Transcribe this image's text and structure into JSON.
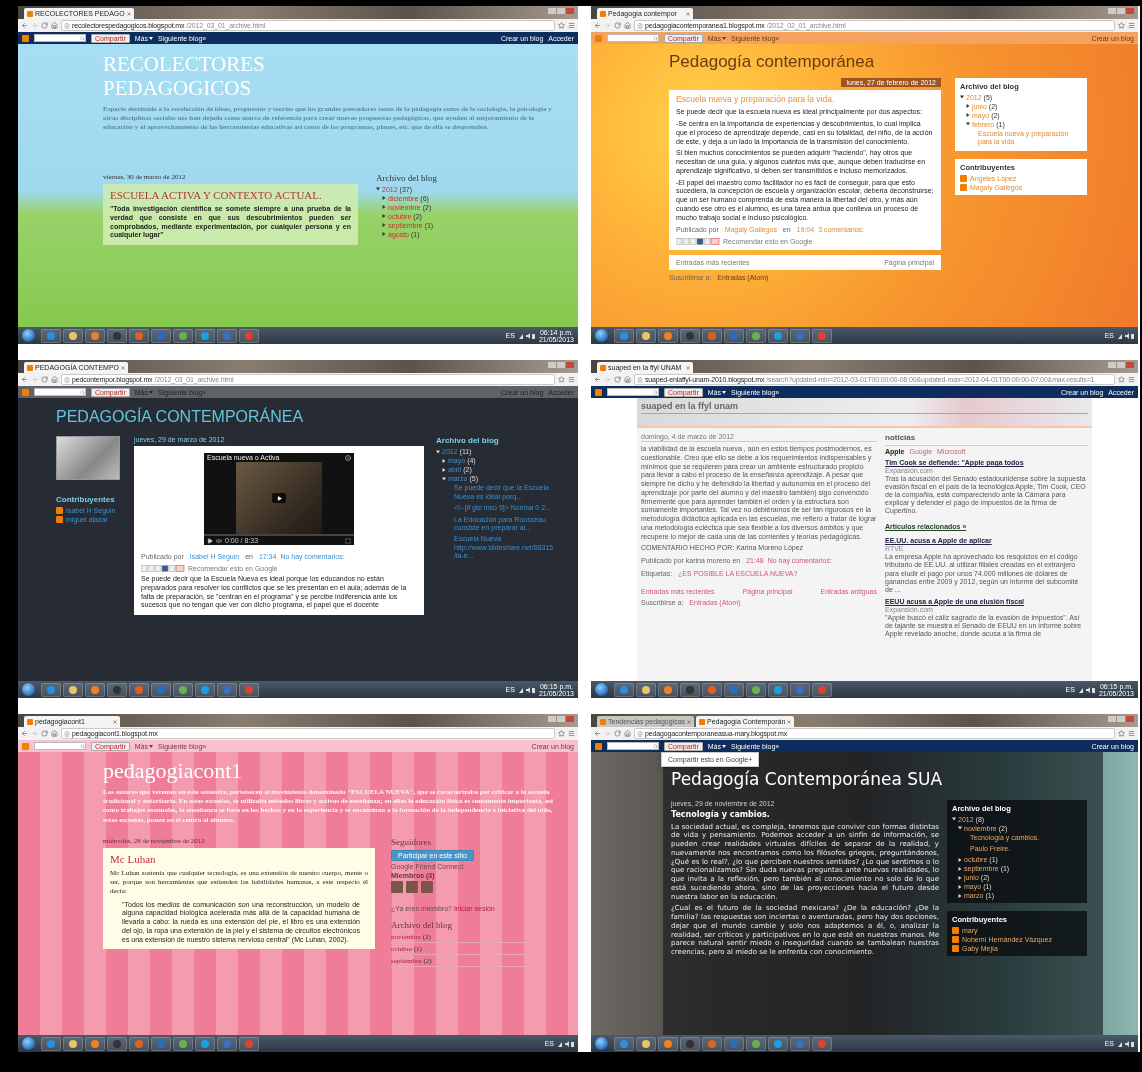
{
  "panels": [
    {
      "kind": "grass",
      "tabs": [
        {
          "label": "RECOLECTORES PEDAGO",
          "selected": true
        }
      ],
      "url": {
        "host": "recolectorespedagogicos.blogspot.mx",
        "path": "/2012_03_01_archive.html"
      },
      "navbar": {
        "share": "Compartir",
        "left": [
          {
            "label": "Más",
            "menu": true
          },
          {
            "label": "Siguiente blog»",
            "menu": false
          }
        ],
        "right": [
          "Crear un blog",
          "Acceder"
        ]
      },
      "header": {
        "title": "RECOLECTORES PEDAGOGICOS",
        "description": "Espacio destinado a la recolección de ideas, propuestas y teorías que los grandes pensadores tanto de la pedagogía como de la sociología, la psicología y otras disciplinas sociales nos han dejado como marco de referencia para crear nuevas propuestas pedagógicas, que ayuden al mejoramiento de la educación y al aprovechamiento de las herramientas educativas así como de los programas, planes, etc. que de ella se desprenden."
      },
      "main": {
        "date": "viernes, 30 de marzo de 2012",
        "post": {
          "title": "ESCUELA ACTIVA Y CONTEXTO ACTUAL.",
          "blocks": [
            {
              "kind": "text",
              "text": "\"Toda investigación científica se somete siempre a una prueba de la verdad que consiste en que sus descubrimientos pueden ser comprobados, mediante experimentación, por cualquier persona y en cualquier lugar\""
            }
          ]
        }
      },
      "sidebar": [
        {
          "kind": "tree",
          "heading": "Archivo del blog",
          "items": [
            {
              "label": "2012",
              "count": "(37)",
              "expanded": true,
              "children": [
                {
                  "label": "diciembre",
                  "count": "(6)",
                  "expanded": false
                },
                {
                  "label": "noviembre",
                  "count": "(2)",
                  "expanded": false
                },
                {
                  "label": "octubre",
                  "count": "(2)",
                  "expanded": false
                },
                {
                  "label": "septiembre",
                  "count": "(1)",
                  "expanded": false
                },
                {
                  "label": "agosto",
                  "count": "(1)",
                  "expanded": false
                }
              ]
            }
          ]
        }
      ],
      "taskbar": {
        "lang": "ES",
        "time": "06:14 p.m.",
        "date": "21/05/2013"
      }
    },
    {
      "kind": "orange",
      "tabs": [
        {
          "label": "Pedagogía contempor",
          "selected": true
        }
      ],
      "url": {
        "host": "pedagogiacontemporanea1.blogspot.mx",
        "path": "/2012_02_01_archive.html"
      },
      "navbar": {
        "share": "Compartir",
        "left": [
          {
            "label": "Más",
            "menu": true
          },
          {
            "label": "Siguiente blog»",
            "menu": false
          }
        ],
        "right": [
          "Crear un blog"
        ]
      },
      "header": {
        "title": "Pedagogía contemporánea"
      },
      "main": {
        "date": "lunes, 27 de febrero de 2012",
        "post": {
          "title": "Escuela nueva y preparación para la vida.",
          "blocks": [
            {
              "kind": "text",
              "text": "Se puede decir que la escuela nueva es ideal principalmente por dos aspectos:"
            },
            {
              "kind": "text",
              "text": "-Se centra en la importancia de experiencias y descubrimientos, lo cual implica que el proceso de aprendizaje depende, casi en su totalidad, del niño, de la acción de este, y deja a un lado la importancia de la transmisión del conocimiento."
            },
            {
              "kind": "text",
              "text": "Si bien muchos conocimientos se pueden adquirir \"haciendo\", hay otros que necesitan de una guía, y algunos cuántos más que, aunque deben traducirse en aprendizaje significativo, si deben ser transmitidos e incluso memorizados."
            },
            {
              "kind": "text",
              "text": "-El papel del maestro como facilitador no es fácil de conseguir, para que esto sucediera, la concepción de escuela y organización escolar, debería deconstruirse; que un ser humano comprenda de esta manera la libertad del otro, y más aún cuando ese otro es el alumno, es una tarea ardua que conlleva un proceso de mucho trabajo social e incluso psicológico."
            },
            {
              "kind": "byline",
              "segments": [
                {
                  "text": "Publicado por ",
                  "link": false
                },
                {
                  "text": "Magaly Gallegos",
                  "link": true
                },
                {
                  "text": " en ",
                  "link": false
                },
                {
                  "text": "19:04",
                  "link": true
                },
                {
                  "text": "3 comentarios:",
                  "link": true
                }
              ]
            },
            {
              "kind": "share",
              "text": "Recomendar esto en Google"
            }
          ]
        },
        "after": [
          {
            "kind": "pager",
            "items": [
              "Entradas más recientes",
              "Página principal"
            ]
          },
          {
            "kind": "subscribe",
            "segments": [
              {
                "text": "Suscribirse a: ",
                "link": false
              },
              {
                "text": "Entradas (Atom)",
                "link": true
              }
            ]
          }
        ]
      },
      "sidebar": [
        {
          "kind": "tree",
          "heading": "Archivo del blog",
          "items": [
            {
              "label": "2012",
              "count": "(5)",
              "expanded": true,
              "children": [
                {
                  "label": "junio",
                  "count": "(2)",
                  "expanded": false
                },
                {
                  "label": "mayo",
                  "count": "(2)",
                  "expanded": false
                },
                {
                  "label": "febrero",
                  "count": "(1)",
                  "expanded": true,
                  "posts": [
                    "Escuela nueva y preparación para la vida"
                  ]
                }
              ]
            }
          ]
        },
        {
          "kind": "people",
          "heading": "Contribuyentes",
          "items": [
            "Angeles López",
            "Magaly Gallegos"
          ]
        }
      ],
      "taskbar": {
        "lang": "ES"
      }
    },
    {
      "kind": "dark",
      "tabs": [
        {
          "label": "PEDAGOGÍA CONTEMPO",
          "selected": true
        }
      ],
      "url": {
        "host": "pedcontempor.blogspot.mx",
        "path": "/2012_03_01_archive.html"
      },
      "navbar": {
        "share": "Compartir",
        "left": [
          {
            "label": "Más",
            "menu": true
          },
          {
            "label": "Siguiente blog»",
            "menu": false
          }
        ],
        "right": [
          "Crear un blog",
          "Acceder"
        ]
      },
      "header": {
        "title": "PEDAGOGÍA CONTEMPORÁNEA"
      },
      "left": [
        {
          "kind": "image"
        },
        {
          "kind": "people",
          "heading": "Contribuyentes",
          "items": [
            "Isabel H Seguin",
            "miguel alazar"
          ]
        }
      ],
      "main": {
        "date": "jueves, 29 de marzo de 2012",
        "post": {
          "blocks": [
            {
              "kind": "video",
              "title": "Escuela nueva o Activa",
              "time": "0:00 / 8:33"
            },
            {
              "kind": "byline",
              "segments": [
                {
                  "text": "Publicado por ",
                  "link": false
                },
                {
                  "text": "Isabel H Seguin",
                  "link": true
                },
                {
                  "text": " en ",
                  "link": false
                },
                {
                  "text": "17:34",
                  "link": true
                },
                {
                  "text": "No hay comentarios:",
                  "link": true
                }
              ]
            },
            {
              "kind": "share",
              "text": "Recomendar esto en Google"
            },
            {
              "kind": "text",
              "text": "Se puede decir que la Escuela Nueva es ideal porque los educandos no están preparados para resolver los conflictos que se les presentan en el aula; además de la falta de preparación, se \"centran en el programa\" y se percibe indiferencia ante los sucesos que no tengan que ver con dicho programa, el papel que el docente"
            }
          ]
        }
      },
      "sidebar": [
        {
          "kind": "tree",
          "heading": "Archivo del blog",
          "items": [
            {
              "label": "2012",
              "count": "(11)",
              "expanded": true,
              "children": [
                {
                  "label": "mayo",
                  "count": "(4)",
                  "expanded": false
                },
                {
                  "label": "abril",
                  "count": "(2)",
                  "expanded": false
                },
                {
                  "label": "marzo",
                  "count": "(5)",
                  "expanded": true,
                  "posts": [
                    "Se puede decir que la Escuela Nueva es ideal porq...",
                    "<!--[if gte mso 9]> Normal 0 2...",
                    "La Educación para Rousseau consiste en preparar al...",
                    "Escuela Nueva http://www.slideshare.net/88315/la-e..."
                  ]
                }
              ]
            }
          ]
        }
      ],
      "taskbar": {
        "lang": "ES",
        "time": "06:15 p.m.",
        "date": "21/05/2013"
      }
    },
    {
      "kind": "plain",
      "tabs": [
        {
          "label": "suaped en la ffyl UNAM",
          "selected": true
        }
      ],
      "url": {
        "host": "suaped-enlaffyl-unam-2010.blogspot.mx",
        "path": "/search?updated-min=2012-03-01T00:00:00-08:00&updated-max=2012-04-01T00:00:00-07:00&max-results=1"
      },
      "navbar": {
        "share": "Compartir",
        "left": [
          {
            "label": "Más",
            "menu": true
          },
          {
            "label": "Siguiente blog»",
            "menu": false
          }
        ],
        "right": [
          "Crear un blog",
          "Acceder"
        ]
      },
      "header": {
        "title": "suaped en la ffyl unam"
      },
      "main": {
        "date": "domingo, 4 de marzo de 2012",
        "post": {
          "blocks": [
            {
              "kind": "text",
              "text": "la viabilidad de la escuela nueva , aún en estos tiempos postmodernos, es cuestionable. Creo que ello se debe a los requerimientos indispensables y mínimos que se requieren para crear un ambiente estructurado propicio para llevar a cabo el proceso de la enseñanza aprendizaje. A pesar que siempre he dicho y he defendido la libertad y autonomía en el proceso del aprendizaje por parte del alumno y del maestro también) sigo convencido firmemente que para aprender también el orden y la estructura son sumamente importantes. Tal vez no debiéramos de ser tan rigurosos en la metodología didáctica aplicada en las escuelas, me refiero a tratar de lograr una metodología ecléctica que sea flexible a los diversos ámbitos y que recupere lo mejor de cada una de las corrientes y teorías pedagógicas."
            },
            {
              "kind": "text",
              "text": "COMENTARIO HECHO POR: Karina Moreno López"
            },
            {
              "kind": "byline",
              "segments": [
                {
                  "text": "Publicado por karina moreno en ",
                  "link": false
                },
                {
                  "text": "21:48",
                  "link": true
                },
                {
                  "text": "No hay comentarios:",
                  "link": true
                }
              ]
            },
            {
              "kind": "byline",
              "segments": [
                {
                  "text": "Etiquetas: ",
                  "link": false
                },
                {
                  "text": "¿ES POSIBLE LA ESCUELA NUEVA?",
                  "link": true
                }
              ]
            }
          ]
        },
        "after": [
          {
            "kind": "pager",
            "items": [
              "Entradas más recientes",
              "Página principal",
              "Entradas antiguas"
            ]
          },
          {
            "kind": "subscribe",
            "segments": [
              {
                "text": "Suscribirse a: ",
                "link": false
              },
              {
                "text": "Entradas (Atom)",
                "link": true
              }
            ]
          }
        ]
      },
      "sidebar": [
        {
          "kind": "news",
          "heading": "noticias",
          "tabs": [
            {
              "label": "Apple",
              "selected": true
            },
            {
              "label": "Google",
              "selected": false
            },
            {
              "label": "Microsoft",
              "selected": false
            }
          ],
          "items": [
            {
              "title": "Tim Cook se defiende: \"Apple paga todos",
              "source": "Expansión.com",
              "text": "Tras la acusación del Senado estadounidense sobre la supuesta evasión fiscal en el país de la tecnológica Apple, Tim Cook, CEO de la compañía, está compareciendo ante la Cámara para explicar y defender el pago de impuestos de la firma de Cupertino.",
              "related": "Artículos relacionados »"
            },
            {
              "title": "EE.UU. acusa a Apple de aplicar",
              "source": "RTVE",
              "text": "La empresa Apple ha aprovechado los resquicios en el código tributario de EE.UU. al utilizar filiales creadas en el extranjero para eludir el pago por unos 74.000 millones de dólares de ganancias entre 2009 y 2012, según un informe del subcomité de ..."
            },
            {
              "title": "EEUU acusa a Apple de una elusión fiscal",
              "source": "Expansión.com",
              "text": "\"Apple buscó el cáliz sagrado de la evasión de impuestos\". Así de tajante se muestra el Senado de EEUU en un informe sobre Apple revelado anoche, donde acusa a la firma de"
            }
          ]
        }
      ],
      "taskbar": {
        "lang": "ES",
        "time": "06:15 p.m.",
        "date": "21/05/2013"
      }
    },
    {
      "kind": "pink",
      "tabs": [
        {
          "label": "pedagogiacont1",
          "selected": true
        }
      ],
      "url": {
        "host": "pedagogiacont1.blogspot.mx"
      },
      "navbar": {
        "share": "Compartir",
        "left": [
          {
            "label": "Más",
            "menu": true
          },
          {
            "label": "Siguiente blog»",
            "menu": false
          }
        ],
        "right": [
          "Crear un blog"
        ]
      },
      "header": {
        "title": "pedagogiacont1",
        "description": "Los autores que veremos en este semestre, pertenecen al movimiento denominado \"ESCUELA NUEVA\", que se caracterizaba por criticar a la escuela tradicional y autoritaria. En estas escuelas, se utilizaba métodos libres y activos de enseñanza; en ellas la educación física es sumamente importante, así como trabajos manuales, la enseñanza se basa en los hechos y en la experiencia y se encaminan a la formación de la independencia e iniciativa del niño, estas escuelas, ponen en el centro al alumno."
      },
      "main": {
        "date": "miércoles, 28 de noviembre de 2012",
        "post": {
          "title": "Mc Luhan",
          "blocks": [
            {
              "kind": "text",
              "text": "Mc Luhan sostenía que cualquier tecnología, es una extensión de nuestro cuerpo, mente o ser, porque son herramientas que extienden las habilidades humanas, a este respecto él decía:"
            },
            {
              "kind": "quote",
              "text": "\"Todos los medios de comunicación son una reconstrucción, un modelo de alguna capacidad biológica acelerada más allá de la capacidad humana de llevarla a cabo: la rueda es una extensión del pie, el libro es una extensión del ojo, la ropa una extensión de la piel y el sistema de circuitos electrónicos es una extensión de nuestro sistema nervioso central\" (Mc Luhan, 2002)."
            }
          ]
        }
      },
      "sidebar": [
        {
          "kind": "followers",
          "heading": "Seguidores",
          "button": "Participar en este sitio",
          "caption": "Google Friend Connect",
          "members": "Miembros (3)",
          "question": "¿Ya eres miembro?",
          "link": "Iniciar sesión"
        },
        {
          "kind": "list",
          "heading": "Archivo del blog",
          "items": [
            {
              "label": "noviembre",
              "count": "(2)"
            },
            {
              "label": "octubre",
              "count": "(1)"
            },
            {
              "label": "septiembre",
              "count": "(2)"
            }
          ]
        }
      ],
      "taskbar": {
        "lang": "ES"
      }
    },
    {
      "kind": "photo",
      "tabs": [
        {
          "label": "Tendencias pedagógicas",
          "selected": false
        },
        {
          "label": "Pedagogía Contemporán",
          "selected": true
        }
      ],
      "url": {
        "host": "pedagogacontemporaneasua-mary.blogspot.mx"
      },
      "navbar": {
        "share": "Compartir",
        "left": [
          {
            "label": "Más",
            "menu": true
          },
          {
            "label": "Siguiente blog»",
            "menu": false
          }
        ],
        "right": [
          "Crear un blog"
        ]
      },
      "popup": "Compartir esto en Google+",
      "header": {
        "title": "Pedagogía Contemporánea SUA"
      },
      "main": {
        "date": "jueves, 29 de noviembre de 2012",
        "post": {
          "title": "Tecnología y cambios.",
          "blocks": [
            {
              "kind": "text",
              "text": "La sociedad actual, es compleja, tenemos que convivir con formas distintas de vida y pensamiento. Podemos acceder a un sinfín de información, se pueden crear realidades virtuales difíciles de separar de la realidad, y nuevamente nos encontramos como los filósofos griegos, preguntándonos, ¿Qué es lo real?, ¿lo que perciben nuestros sentidos? ¿Lo que sentimos o lo que racionalizamos? Sin duda nuevas preguntas ante nuevas realidades, lo que invita a la reflexión, pero también al conocimiento no solo de lo que está sucediendo ahora, sino de las proyecciones hacia el futuro desde nuestra labor en la educación."
            },
            {
              "kind": "text",
              "text": "¿Cual es el futuro de la sociedad mexicana? ¿De la educación? ¿De la familia? las respuestas son inciertas o aventuradas, pero hay dos opciones, dejar que el mundo cambie y solo nos adaptemos a él, o, analizar la realidad, ser críticos y participativos en lo que esté en nuestras manos. Me parece natural sentir miedo o inseguridad cuando se tambalean nuestras creencias, pero al miedo se le enfrenta con conocimiento."
            }
          ]
        }
      },
      "sidebar": [
        {
          "kind": "tree",
          "heading": "Archivo del blog",
          "items": [
            {
              "label": "2012",
              "count": "(8)",
              "expanded": true,
              "children": [
                {
                  "label": "noviembre",
                  "count": "(2)",
                  "expanded": true,
                  "posts": [
                    "Tecnología y cambios.",
                    "Paulo Freire."
                  ]
                },
                {
                  "label": "octubre",
                  "count": "(1)",
                  "expanded": false
                },
                {
                  "label": "septiembre",
                  "count": "(1)",
                  "expanded": false
                },
                {
                  "label": "junio",
                  "count": "(2)",
                  "expanded": false
                },
                {
                  "label": "mayo",
                  "count": "(1)",
                  "expanded": false
                },
                {
                  "label": "marzo",
                  "count": "(1)",
                  "expanded": false
                }
              ]
            }
          ]
        },
        {
          "kind": "people",
          "heading": "Contribuyentes",
          "items": [
            "mary",
            "Nohemí Hernández Vázquez",
            "Gaby Mejía"
          ]
        }
      ],
      "taskbar": {
        "lang": "ES"
      }
    }
  ]
}
